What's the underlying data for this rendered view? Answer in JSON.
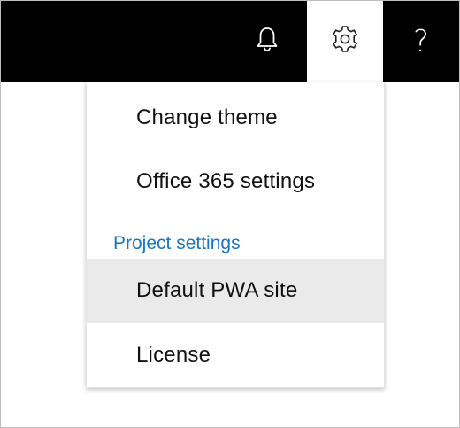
{
  "header": {
    "icons": {
      "notifications": "bell-icon",
      "settings": "gear-icon",
      "help": "question-mark-icon"
    },
    "help_glyph": "?"
  },
  "settings_menu": {
    "items": [
      {
        "label": "Change theme"
      },
      {
        "label": "Office 365 settings"
      }
    ],
    "section": {
      "title": "Project settings",
      "items": [
        {
          "label": "Default PWA site",
          "highlighted": true
        },
        {
          "label": "License"
        }
      ]
    }
  },
  "colors": {
    "topbar": "#000000",
    "active_tab": "#ffffff",
    "section_heading": "#1976c5",
    "hover_item": "#eaeaea"
  }
}
